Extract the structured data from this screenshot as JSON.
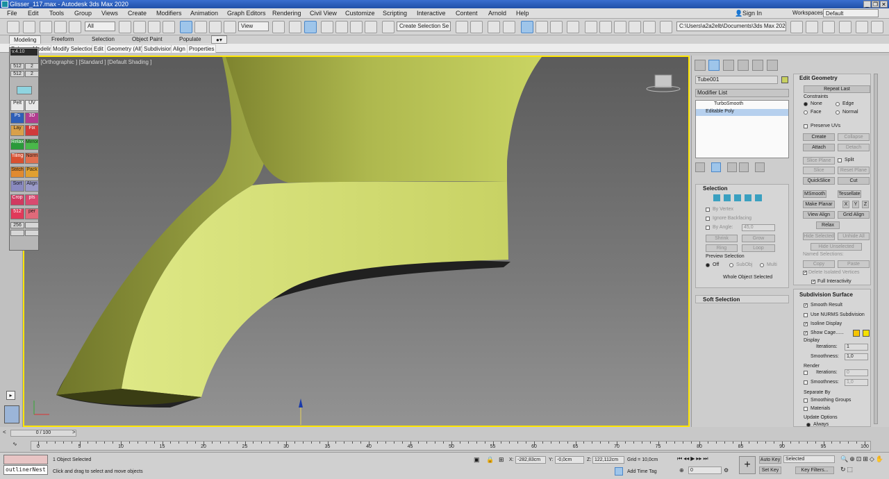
{
  "window": {
    "title": "Glisser_117.max - Autodesk 3ds Max 2020",
    "controls": [
      "_",
      "❐",
      "✕"
    ]
  },
  "menu": [
    "File",
    "Edit",
    "Tools",
    "Group",
    "Views",
    "Create",
    "Modifiers",
    "Animation",
    "Graph Editors",
    "Rendering",
    "Civil View",
    "Customize",
    "Scripting",
    "Interactive",
    "Content",
    "Arnold",
    "Help"
  ],
  "account": {
    "signin": "Sign In",
    "workspaces_label": "Workspaces:",
    "workspace": "Default"
  },
  "toolbar": {
    "filter": "All",
    "refcoord": "View",
    "selset": "Create Selection Se",
    "path": "C:\\Users\\a2a2elb\\Documents\\3ds Max 2020"
  },
  "ribbon": {
    "tabs": [
      "Modeling",
      "Freeform",
      "Selection",
      "Object Paint",
      "Populate"
    ],
    "sub": [
      "Polygon Modeling",
      "Modify Selection",
      "Edit",
      "Geometry (All)",
      "Subdivision",
      "Align",
      "Properties"
    ]
  },
  "float_panel": {
    "version": "v.4.10",
    "cells": [
      "512",
      "2",
      "512",
      "2",
      "Pelt",
      "UV",
      "Ps",
      "3D",
      "Lay",
      "Fix",
      "Relax",
      "Mirror",
      "Tiling",
      "Norm",
      "Stitch",
      "Pack",
      "Sort",
      "Align",
      "Crop",
      "pls",
      "512",
      "per",
      "256"
    ]
  },
  "viewport": {
    "label": "[+] [Orthographic ] [Standard ] [Default Shading ]",
    "colors": {
      "object": "#c6d068",
      "border": "#ffe600"
    }
  },
  "command_panel": {
    "object_name": "Tube001",
    "object_color": "#c8d060",
    "modifier_list": "Modifier List",
    "stack": [
      "TurboSmooth",
      "Editable Poly"
    ],
    "selection": {
      "title": "Selection",
      "by_vertex": "By Vertex",
      "ignore_backfacing": "Ignore Backfacing",
      "by_angle": "By Angle:",
      "angle": "45,0",
      "shrink": "Shrink",
      "grow": "Grow",
      "ring": "Ring",
      "loop": "Loop",
      "preview": "Preview Selection",
      "off": "Off",
      "subobj": "SubObj",
      "multi": "Multi",
      "status": "Whole Object Selected"
    },
    "soft_selection": "Soft Selection",
    "edit_geometry": {
      "title": "Edit Geometry",
      "repeat_last": "Repeat Last",
      "constraints": "Constraints",
      "none": "None",
      "edge": "Edge",
      "face": "Face",
      "normal": "Normal",
      "preserve_uvs": "Preserve UVs",
      "create": "Create",
      "collapse": "Collapse",
      "attach": "Attach",
      "detach": "Detach",
      "slice_plane": "Slice Plane",
      "split": "Split",
      "slice": "Slice",
      "reset_plane": "Reset Plane",
      "quickslice": "QuickSlice",
      "cut": "Cut",
      "msmooth": "MSmooth",
      "tessellate": "Tessellate",
      "make_planar": "Make Planar",
      "x": "X",
      "y": "Y",
      "z": "Z",
      "view_align": "View Align",
      "grid_align": "Grid Align",
      "relax": "Relax",
      "hide_selected": "Hide Selected",
      "unhide_all": "Unhide All",
      "hide_unselected": "Hide Unselected",
      "named_selections": "Named Selections:",
      "copy": "Copy",
      "paste": "Paste",
      "delete_isolated": "Delete Isolated Vertices",
      "full_interactivity": "Full Interactivity"
    },
    "subdivision": {
      "title": "Subdivision Surface",
      "smooth_result": "Smooth Result",
      "use_nurms": "Use NURMS Subdivision",
      "isoline": "Isoline Display",
      "show_cage": "Show Cage......",
      "cage_colors": [
        "#f5c400",
        "#f5e000"
      ],
      "display": "Display",
      "iterations_label": "Iterations:",
      "iterations": "1",
      "smoothness_label": "Smoothness:",
      "smoothness": "1,0",
      "render": "Render",
      "r_iterations": "0",
      "r_smoothness": "1,0",
      "separate_by": "Separate By",
      "smoothing_groups": "Smoothing Groups",
      "materials": "Materials",
      "update_options": "Update Options",
      "always": "Always"
    }
  },
  "timeline": {
    "slider": "0 / 100",
    "ticks": [
      "0",
      "5",
      "10",
      "15",
      "20",
      "25",
      "30",
      "35",
      "40",
      "45",
      "50",
      "55",
      "60",
      "65",
      "70",
      "75",
      "80",
      "85",
      "90",
      "95",
      "100"
    ]
  },
  "status": {
    "script": "outlinerNest",
    "selected": "1 Object Selected",
    "hint": "Click and drag to select and move objects",
    "x_label": "X:",
    "x": "-282,83cm",
    "y_label": "Y:",
    "y": "-0,0cm",
    "z_label": "Z:",
    "z": "122,112cm",
    "grid": "Grid = 10,0cm",
    "add_time_tag": "Add Time Tag",
    "frame": "0",
    "auto_key": "Auto Key",
    "key_mode": "Selected",
    "set_key": "Set Key",
    "key_filters": "Key Filters..."
  }
}
